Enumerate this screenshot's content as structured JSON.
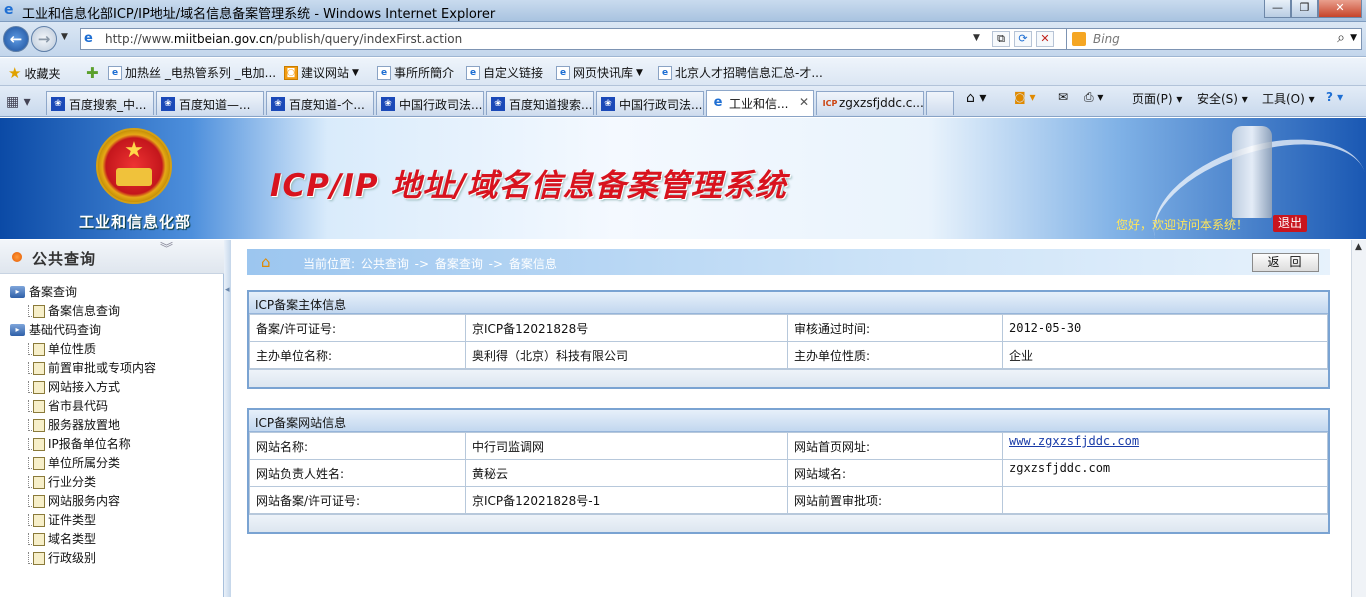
{
  "window": {
    "title": "工业和信息化部ICP/IP地址/域名信息备案管理系统 - Windows Internet Explorer"
  },
  "address": {
    "url_prefix": "http://www.",
    "url_domain": "miitbeian.gov.cn",
    "url_path": "/publish/query/indexFirst.action"
  },
  "search": {
    "placeholder": "Bing"
  },
  "favorites": {
    "label": "收藏夹",
    "items": [
      {
        "label": "加热丝 _电热管系列 _电加..."
      },
      {
        "label": "建议网站"
      },
      {
        "label": "事所所簡介"
      },
      {
        "label": "自定义链接"
      },
      {
        "label": "网页快讯库"
      },
      {
        "label": "北京人才招聘信息汇总-才..."
      }
    ]
  },
  "tabs": [
    {
      "label": "百度搜索_中..."
    },
    {
      "label": "百度知道—..."
    },
    {
      "label": "百度知道-个..."
    },
    {
      "label": "中国行政司法..."
    },
    {
      "label": "百度知道搜索..."
    },
    {
      "label": "中国行政司法..."
    },
    {
      "label": "工业和信..."
    },
    {
      "label": "zgxzsfjddc.c..."
    }
  ],
  "commandbar": {
    "page": "页面(P)",
    "safety": "安全(S)",
    "tools": "工具(O)"
  },
  "banner": {
    "ministry": "工业和信息化部",
    "system_name": "ICP/IP 地址/域名信息备案管理系统",
    "welcome": "您好，欢迎访问本系统！",
    "logout": "退出"
  },
  "sidebar": {
    "title": "公共查询",
    "groups": [
      {
        "label": "备案查询",
        "items": [
          "备案信息查询"
        ]
      },
      {
        "label": "基础代码查询",
        "items": [
          "单位性质",
          "前置审批或专项内容",
          "网站接入方式",
          "省市县代码",
          "服务器放置地",
          "IP报备单位名称",
          "单位所属分类",
          "行业分类",
          "网站服务内容",
          "证件类型",
          "域名类型",
          "行政级别"
        ]
      }
    ]
  },
  "breadcrumb": {
    "text": "当前位置: 公共查询  -> 备案查询  -> 备案信息"
  },
  "back_button": "返回",
  "subject_panel": {
    "title": "ICP备案主体信息",
    "rows": [
      {
        "k1": "备案/许可证号:",
        "v1": "京ICP备12021828号",
        "k2": "审核通过时间:",
        "v2": "2012-05-30"
      },
      {
        "k1": "主办单位名称:",
        "v1": "奥利得（北京）科技有限公司",
        "k2": "主办单位性质:",
        "v2": "企业"
      }
    ]
  },
  "site_panel": {
    "title": "ICP备案网站信息",
    "rows": [
      {
        "k1": "网站名称:",
        "v1": "中行司监调网",
        "k2": "网站首页网址:",
        "v2": "www.zgxzsfjddc.com"
      },
      {
        "k1": "网站负责人姓名:",
        "v1": "黄秘云",
        "k2": "网站域名:",
        "v2": "zgxzsfjddc.com"
      },
      {
        "k1": "网站备案/许可证号:",
        "v1": "京ICP备12021828号-1",
        "k2": "网站前置审批项:",
        "v2": ""
      }
    ]
  }
}
